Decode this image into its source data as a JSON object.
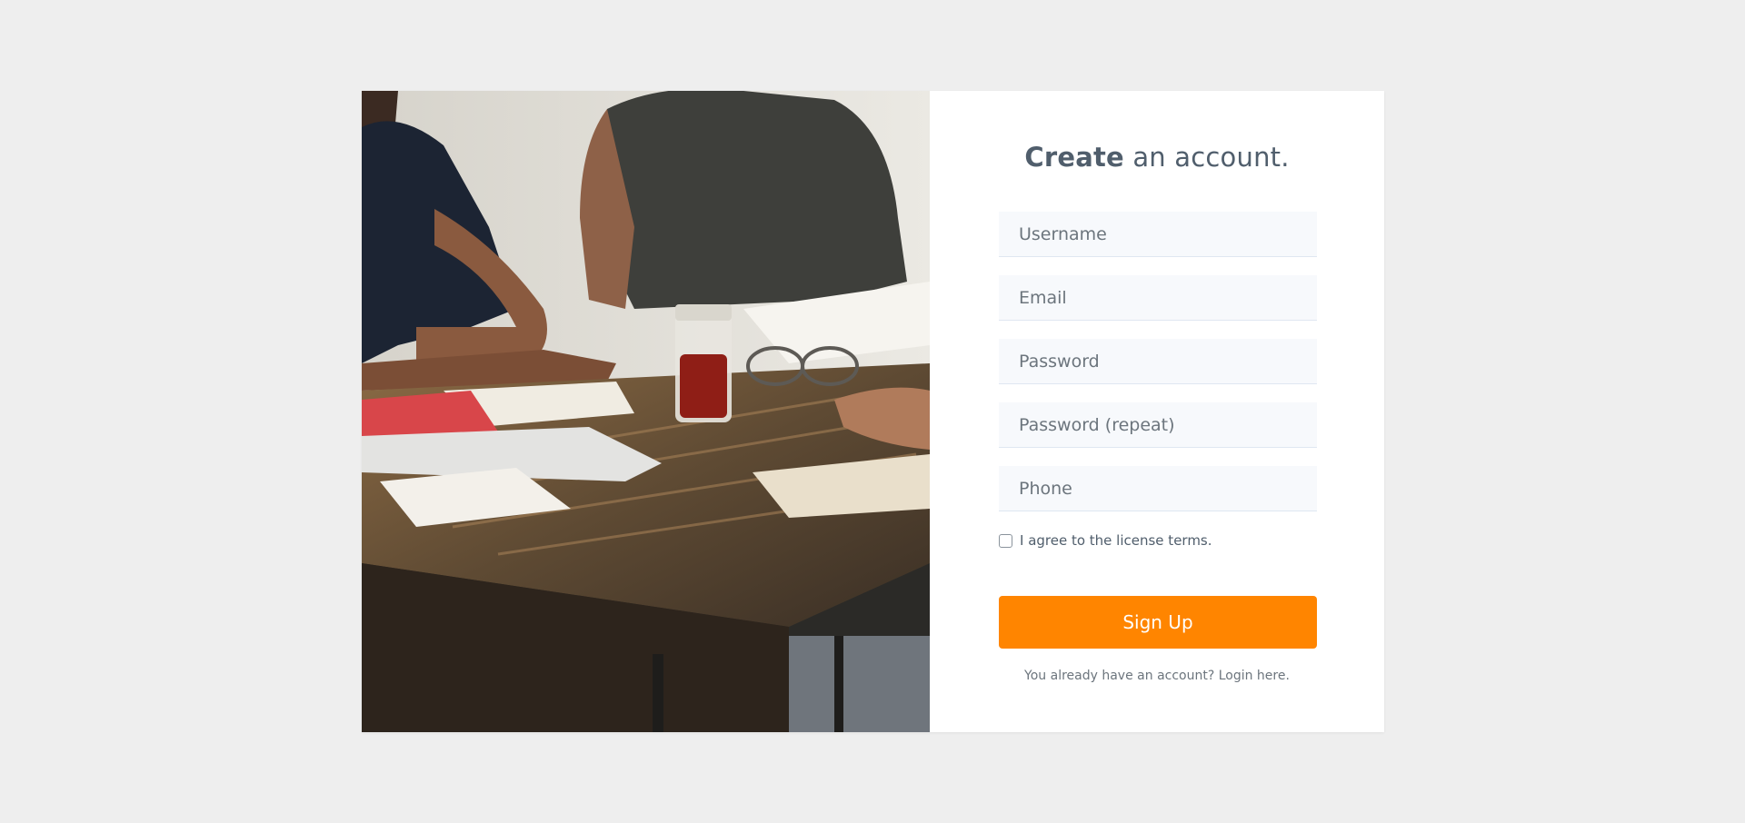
{
  "form": {
    "title_bold": "Create",
    "title_rest": " an account.",
    "fields": [
      {
        "placeholder": "Username",
        "value": ""
      },
      {
        "placeholder": "Email",
        "value": ""
      },
      {
        "placeholder": "Password",
        "value": ""
      },
      {
        "placeholder": "Password (repeat)",
        "value": ""
      },
      {
        "placeholder": "Phone",
        "value": ""
      }
    ],
    "agree_label": "I agree to the license terms.",
    "agree_checked": false,
    "submit_label": "Sign Up",
    "login_prompt": "You already have an account? Login here."
  },
  "colors": {
    "page_background": "#eeeeee",
    "accent": "#ff8500",
    "text": "#505e6c",
    "field_background": "#f7f9fc"
  },
  "image": {
    "description_icon": "photo-icon"
  }
}
